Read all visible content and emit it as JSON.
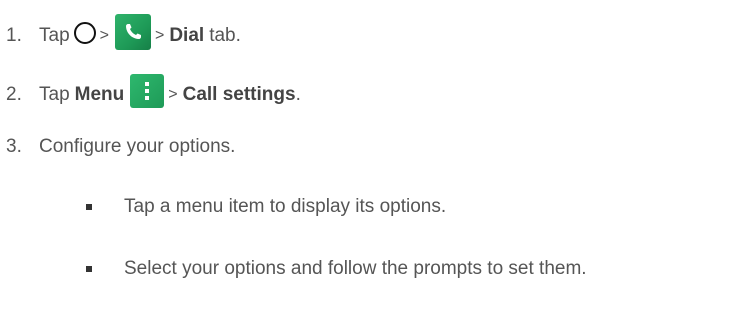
{
  "steps": [
    {
      "number": "1.",
      "prefix": "Tap",
      "sep1": ">",
      "sep2": ">",
      "bold": "Dial",
      "suffix": "tab."
    },
    {
      "number": "2.",
      "prefix": "Tap",
      "bold1": "Menu",
      "sep": ">",
      "bold2": "Call settings",
      "suffix": "."
    },
    {
      "number": "3.",
      "text": "Configure your options."
    }
  ],
  "bullets": [
    "Tap a menu item to display its options.",
    "Select your options and follow the prompts to set them."
  ],
  "icons": {
    "home": "home-circle-icon",
    "phone": "phone-app-icon",
    "menu": "menu-dots-icon"
  },
  "colors": {
    "text": "#555555",
    "icon_green": "#1e9a57"
  }
}
